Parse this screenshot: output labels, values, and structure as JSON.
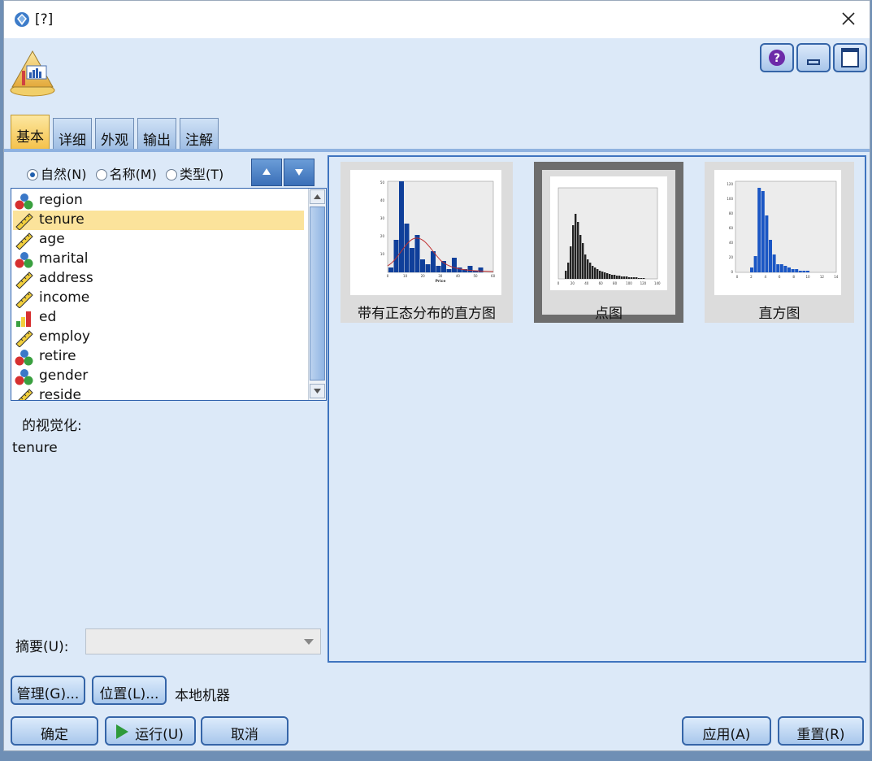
{
  "window": {
    "title": "[?]"
  },
  "tabs": [
    {
      "label": "基本",
      "active": true
    },
    {
      "label": "详细"
    },
    {
      "label": "外观"
    },
    {
      "label": "输出"
    },
    {
      "label": "注解"
    }
  ],
  "sort": {
    "natural": "自然(N)",
    "name": "名称(M)",
    "type": "类型(T)",
    "selected": "natural"
  },
  "fields": [
    {
      "label": "region",
      "icon": "nominal-icon"
    },
    {
      "label": "tenure",
      "icon": "continuous-ruler-icon",
      "selected": true
    },
    {
      "label": "age",
      "icon": "continuous-ruler-icon"
    },
    {
      "label": "marital",
      "icon": "nominal-icon"
    },
    {
      "label": "address",
      "icon": "continuous-ruler-icon"
    },
    {
      "label": "income",
      "icon": "continuous-ruler-icon"
    },
    {
      "label": "ed",
      "icon": "ordinal-bar-icon"
    },
    {
      "label": "employ",
      "icon": "continuous-ruler-icon"
    },
    {
      "label": "retire",
      "icon": "nominal-icon"
    },
    {
      "label": "gender",
      "icon": "nominal-icon"
    },
    {
      "label": "reside",
      "icon": "continuous-ruler-icon"
    }
  ],
  "visualization": {
    "label": "的视觉化:",
    "value": "tenure"
  },
  "summary": {
    "label": "摘要(U):",
    "value": ""
  },
  "graph_types": [
    {
      "label": "带有正态分布的直方图",
      "selected": false
    },
    {
      "label": "点图",
      "selected": true
    },
    {
      "label": "直方图",
      "selected": false
    }
  ],
  "thumb_axes": {
    "hist_normal_x": [
      "0",
      "10",
      "20",
      "30",
      "40",
      "50",
      "60"
    ],
    "hist_normal_y": [
      "10",
      "20",
      "30",
      "40",
      "50"
    ],
    "hist_normal_xlabel": "Price",
    "dot_x": [
      "0",
      "20",
      "40",
      "60",
      "80",
      "100",
      "120",
      "140"
    ],
    "hist_x": [
      "0",
      "2",
      "4",
      "6",
      "8",
      "10",
      "12",
      "14"
    ],
    "hist_y": [
      "0",
      "20",
      "40",
      "60",
      "80",
      "100",
      "120"
    ]
  },
  "buttons": {
    "manage": "管理(G)...",
    "location": "位置(L)...",
    "location_value": "本地机器",
    "ok": "确定",
    "run": "运行(U)",
    "cancel": "取消",
    "apply": "应用(A)",
    "reset": "重置(R)"
  },
  "colors": {
    "accent": "#3565a8",
    "selection": "#fbe39b",
    "bars": "#0f3f9a",
    "active_tab": "#f4c048"
  }
}
